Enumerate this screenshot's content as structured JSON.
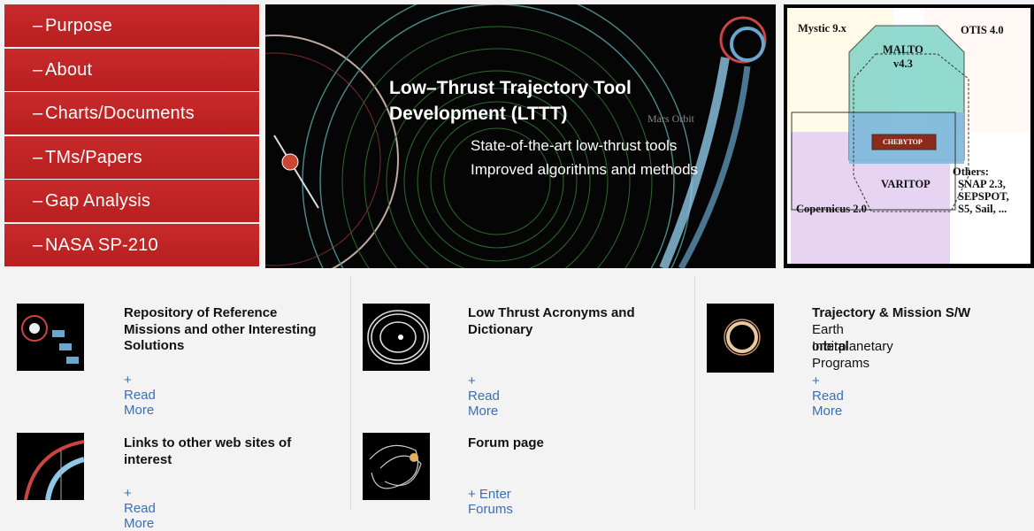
{
  "nav": {
    "items": [
      {
        "label": "Purpose"
      },
      {
        "label": "About"
      },
      {
        "label": "Charts/Documents"
      },
      {
        "label": "TMs/Papers"
      },
      {
        "label": "Gap Analysis"
      },
      {
        "label": "NASA SP-210"
      }
    ]
  },
  "hero": {
    "title": "Low–Thrust Trajectory Tool Development (LTTT)",
    "line1": "State-of-the-art low-thrust tools",
    "line2": "Improved algorithms and methods",
    "orbit_label": "Mars Orbit"
  },
  "diagram": {
    "mystic": "Mystic 9.x",
    "otis": "OTIS 4.0",
    "malto": "MALTO",
    "malto_version": "v4.3",
    "chebytop": "CHEBYTOP",
    "varitop": "VARITOP",
    "copernicus": "Copernicus 2.0",
    "others": "Others:",
    "others_1": "SNAP 2.3,",
    "others_2": "SEPSPOT,",
    "others_3": "S5, Sail, ..."
  },
  "cards": [
    {
      "title": "Repository of Reference Missions and other Interesting Solutions",
      "link": "+ Read More"
    },
    {
      "title": "Low Thrust Acronyms and Dictionary",
      "link": "+ Read More"
    },
    {
      "title": "Trajectory & Mission S/W",
      "sub1": "Earth orbital",
      "sub2": "Interplanetary Programs",
      "link": "+ Read More"
    },
    {
      "title": "Links to other web sites of interest",
      "link": "+ Read More"
    },
    {
      "title": "Forum page",
      "link": "+ Enter Forums"
    }
  ],
  "colors": {
    "nav_red": "#c22626",
    "link_blue": "#3b6fb4"
  }
}
